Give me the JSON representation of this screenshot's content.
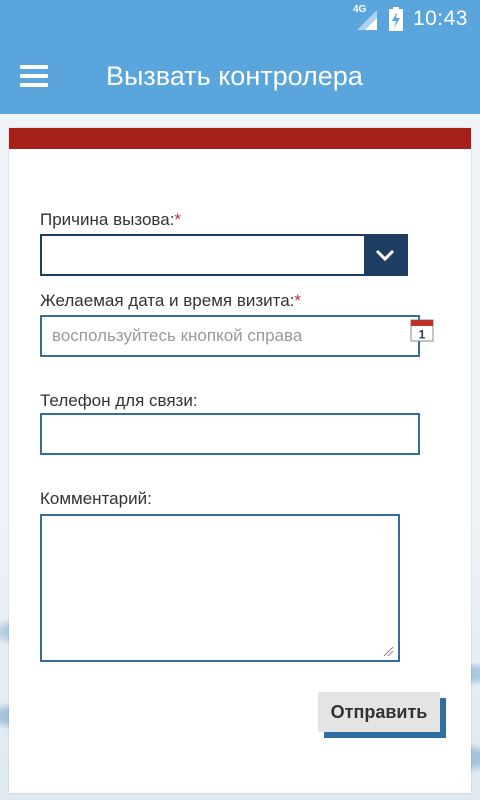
{
  "status_bar": {
    "network": "4G",
    "time": "10:43"
  },
  "app_bar": {
    "title": "Вызвать контролера"
  },
  "form": {
    "reason": {
      "label": "Причина вызова:",
      "required_mark": "*",
      "value": ""
    },
    "datetime": {
      "label": "Желаемая дата и время визита:",
      "required_mark": "*",
      "placeholder": "воспользуйтесь кнопкой справа",
      "calendar_day": "1"
    },
    "phone": {
      "label": "Телефон для связи:",
      "value": ""
    },
    "comment": {
      "label": "Комментарий:",
      "value": ""
    },
    "submit_label": "Отправить"
  },
  "colors": {
    "primary": "#5aa5dc",
    "header_bar": "#a52019",
    "field_border": "#336e9e",
    "select_dark": "#1f3e63",
    "required": "#c0302a"
  }
}
